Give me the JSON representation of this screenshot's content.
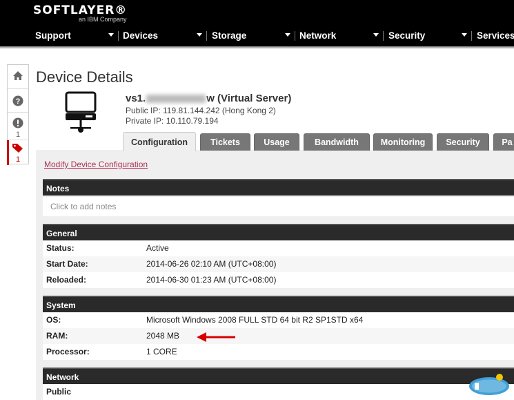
{
  "header": {
    "logo": "SOFTLAYER®",
    "logo_sub": "an IBM Company",
    "nav": [
      "Support",
      "Devices",
      "Storage",
      "Network",
      "Security",
      "Services"
    ]
  },
  "rail": {
    "icons": [
      "home-icon",
      "help-icon",
      "alert-icon",
      "tag-icon"
    ],
    "alert_count": "1",
    "tag_count": "1"
  },
  "page": {
    "title": "Device Details",
    "device_name_prefix": "vs1.",
    "device_name_suffix": "w (Virtual Server)",
    "public_ip": "Public IP: 119.81.144.242 (Hong Kong 2)",
    "private_ip": "Private IP: 10.110.79.194"
  },
  "tabs": [
    "Configuration",
    "Tickets",
    "Usage",
    "Bandwidth",
    "Monitoring",
    "Security",
    "Pa"
  ],
  "modify_link": "Modify Device Configuration",
  "notes": {
    "heading": "Notes",
    "placeholder": "Click to add notes"
  },
  "general": {
    "heading": "General",
    "rows": [
      {
        "label": "Status:",
        "value": "Active"
      },
      {
        "label": "Start Date:",
        "value": "2014-06-26 02:10 AM (UTC+08:00)"
      },
      {
        "label": "Reloaded:",
        "value": "2014-06-30 01:23 AM (UTC+08:00)"
      }
    ]
  },
  "system": {
    "heading": "System",
    "rows": [
      {
        "label": "OS:",
        "value": "Microsoft Windows 2008 FULL STD 64 bit R2 SP1STD x64"
      },
      {
        "label": "RAM:",
        "value": "2048 MB"
      },
      {
        "label": "Processor:",
        "value": "1 CORE"
      }
    ]
  },
  "network": {
    "heading": "Network",
    "rows": [
      {
        "label": "Public",
        "value": ""
      }
    ]
  },
  "colors": {
    "header_bg": "#000000",
    "link": "#b03052",
    "accent_red": "#cc0000",
    "tab_bg": "#777777"
  }
}
